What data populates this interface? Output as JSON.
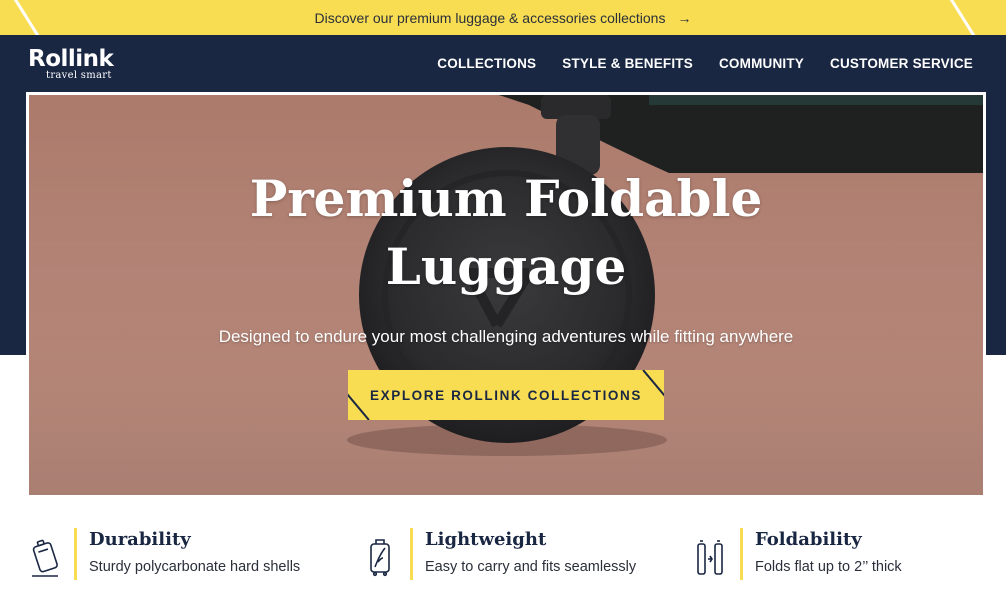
{
  "announcement": {
    "text": "Discover our premium luggage & accessories collections",
    "arrow": "→"
  },
  "logo": {
    "name": "Rollink",
    "tagline": "travel smart"
  },
  "nav": {
    "items": [
      {
        "label": "COLLECTIONS"
      },
      {
        "label": "STYLE & BENEFITS"
      },
      {
        "label": "COMMUNITY"
      },
      {
        "label": "CUSTOMER SERVICE"
      }
    ]
  },
  "hero": {
    "title": "Premium Foldable Luggage",
    "subtitle": "Designed to endure your most challenging adventures while fitting anywhere",
    "cta_label": "EXPLORE ROLLINK COLLECTIONS"
  },
  "features": [
    {
      "title": "Durability",
      "description": "Sturdy polycarbonate hard shells",
      "icon": "suitcase-tilted-icon"
    },
    {
      "title": "Lightweight",
      "description": "Easy to carry and fits seamlessly",
      "icon": "suitcase-feather-icon"
    },
    {
      "title": "Foldability",
      "description": "Folds flat up to 2’’ thick",
      "icon": "folding-suitcase-icon"
    }
  ],
  "colors": {
    "accent_yellow": "#f8dd52",
    "navy": "#1a2743",
    "white": "#ffffff"
  }
}
